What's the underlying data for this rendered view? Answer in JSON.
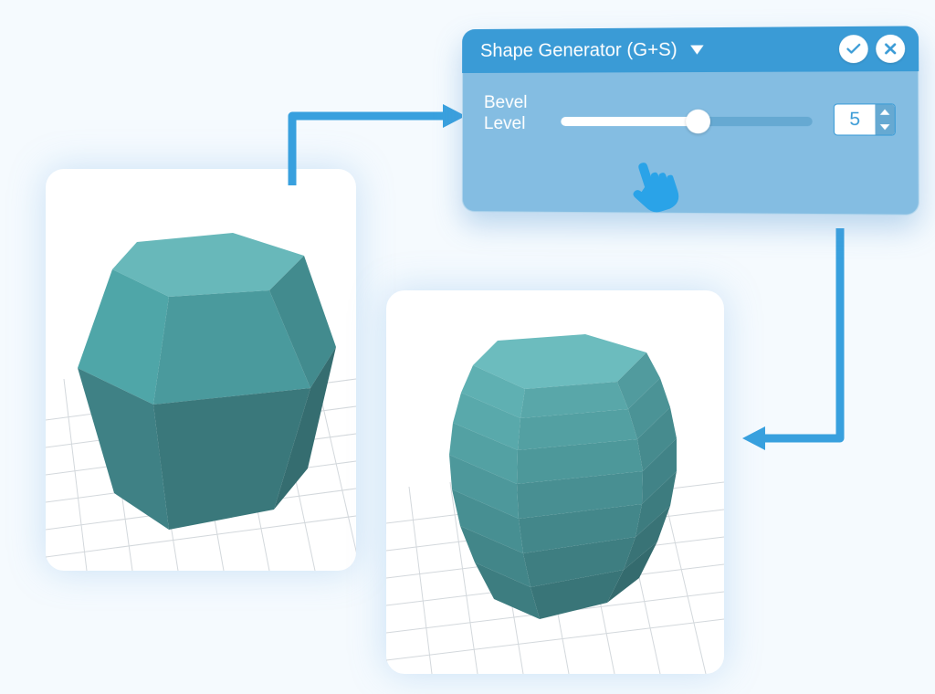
{
  "panel": {
    "title": "Shape Generator (G+S)",
    "field_label_line1": "Bevel",
    "field_label_line2": "Level",
    "value": "5",
    "slider_percent": 55
  },
  "colors": {
    "accent": "#3a9bd6",
    "panel_body": "#84bde2",
    "shape_top": "#64b4b6",
    "shape_light": "#4fa6a8",
    "shape_mid": "#458f92",
    "shape_dark": "#3c7c7f",
    "arrow": "#38a0de"
  },
  "viewports": {
    "left": {
      "desc": "low-poly hexagonal barrel, bevel level ~1"
    },
    "right": {
      "desc": "hexagonal barrel with more bevel segments, bevel level 5"
    }
  }
}
